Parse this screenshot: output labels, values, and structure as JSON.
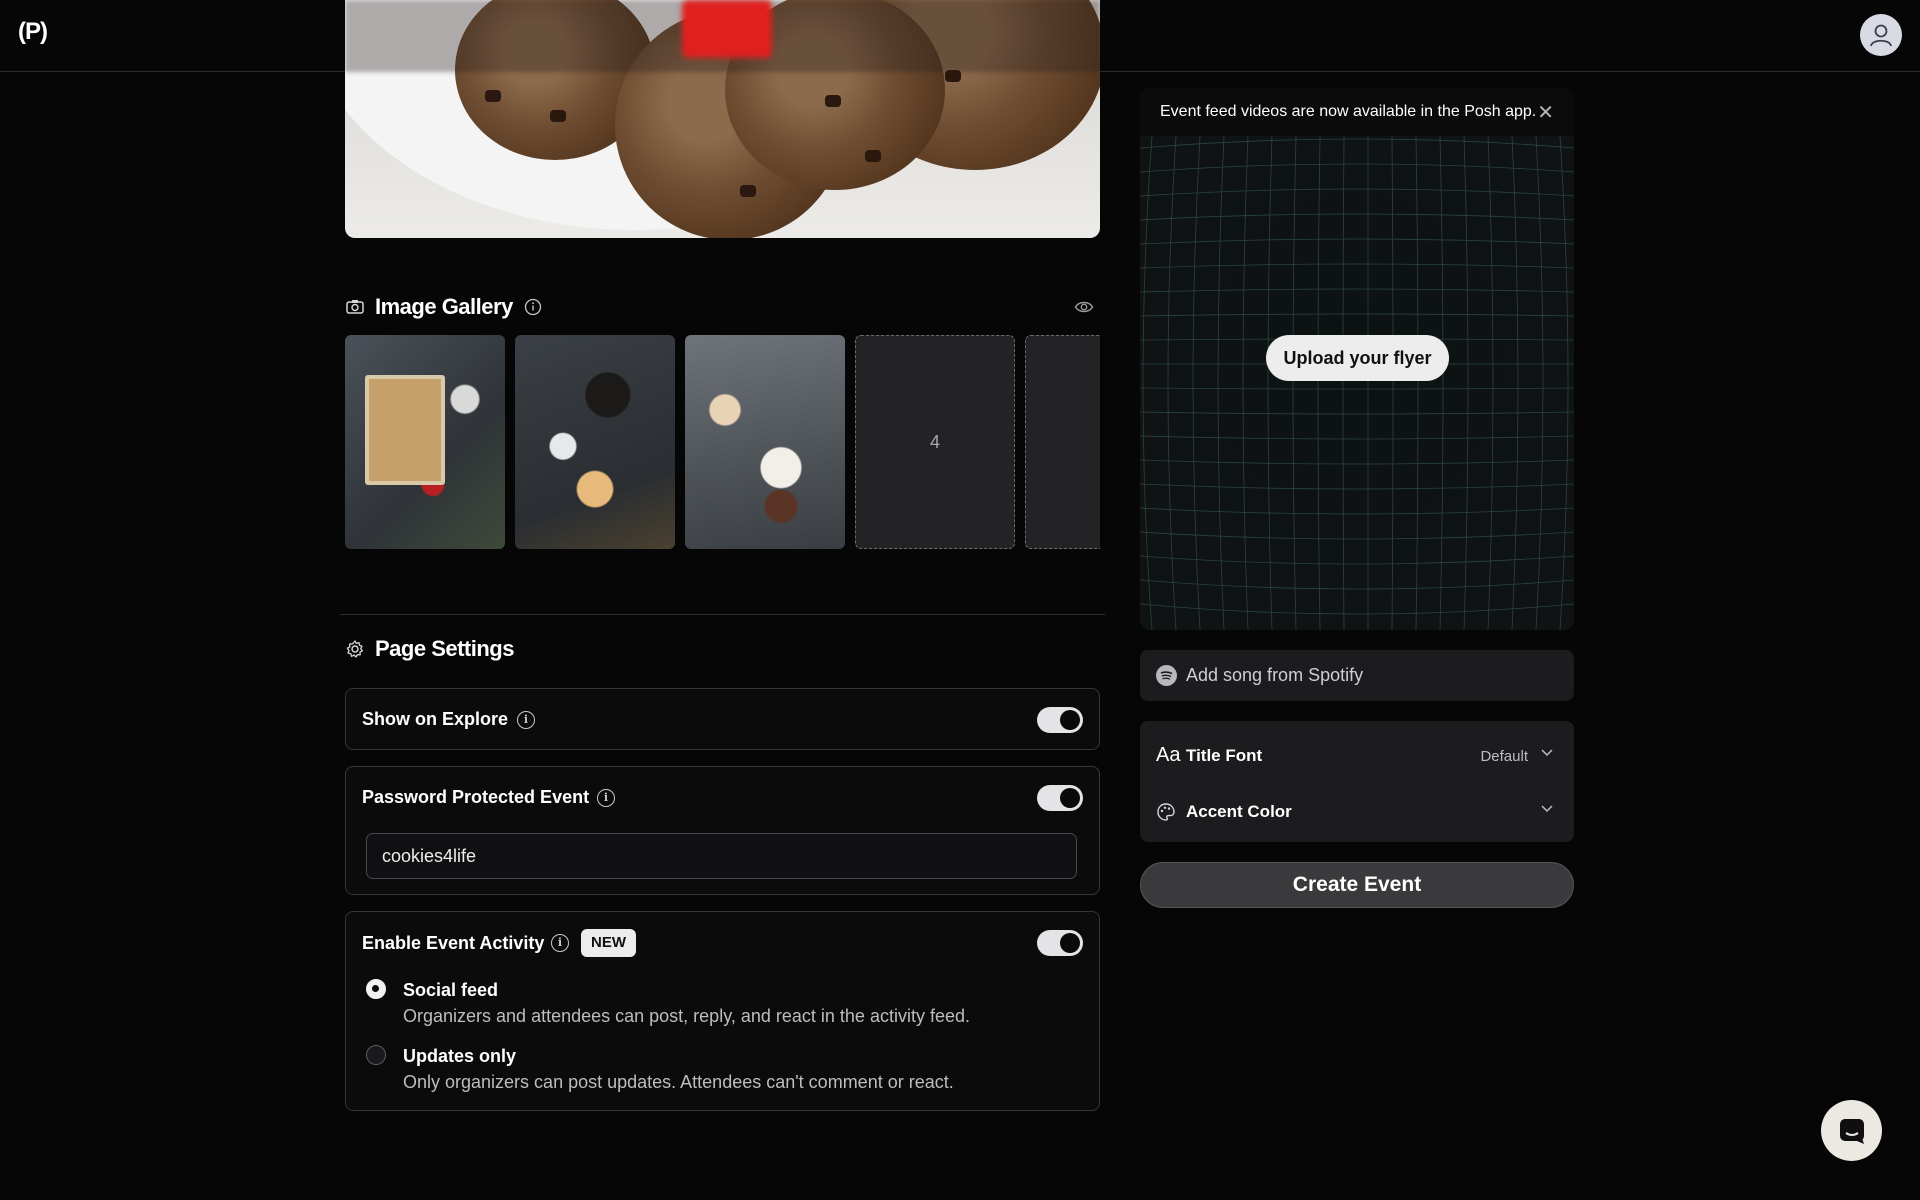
{
  "header": {
    "logo_text": "(P)",
    "avatar_icon": "user-icon"
  },
  "gallery": {
    "title": "Image Gallery",
    "empty_slot_number": "4"
  },
  "page_settings": {
    "title": "Page Settings",
    "show_on_explore": {
      "label": "Show on Explore",
      "enabled": true
    },
    "password_protected": {
      "label": "Password Protected Event",
      "enabled": true,
      "password_value": "cookies4life"
    },
    "event_activity": {
      "label": "Enable Event Activity",
      "badge": "NEW",
      "enabled": true,
      "options": [
        {
          "title": "Social feed",
          "description": "Organizers and attendees can post, reply, and react in the activity feed.",
          "selected": true
        },
        {
          "title": "Updates only",
          "description": "Only organizers can post updates. Attendees can't comment or react.",
          "selected": false
        }
      ]
    }
  },
  "flyer": {
    "banner_text": "Event feed videos are now available in the Posh app.",
    "upload_label": "Upload your flyer"
  },
  "spotify": {
    "placeholder": "Add song from Spotify"
  },
  "appearance": {
    "title_font_icon": "Aa",
    "title_font_label": "Title Font",
    "title_font_value": "Default",
    "accent_color_label": "Accent Color"
  },
  "create_button": "Create Event",
  "colors": {
    "background": "#060607",
    "card_border": "#36363a",
    "toggle_on": "#e4e4e6",
    "panel": "#1c1c1e"
  }
}
